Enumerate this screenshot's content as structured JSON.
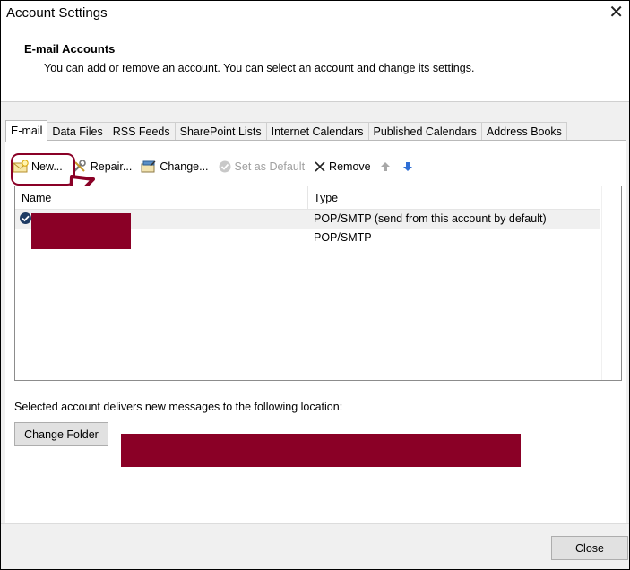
{
  "window": {
    "title": "Account Settings"
  },
  "header": {
    "title": "E-mail Accounts",
    "subtitle": "You can add or remove an account. You can select an account and change its settings."
  },
  "tabs": [
    {
      "label": "E-mail",
      "active": true
    },
    {
      "label": "Data Files"
    },
    {
      "label": "RSS Feeds"
    },
    {
      "label": "SharePoint Lists"
    },
    {
      "label": "Internet Calendars"
    },
    {
      "label": "Published Calendars"
    },
    {
      "label": "Address Books"
    }
  ],
  "toolbar": {
    "new_label": "New...",
    "repair_label": "Repair...",
    "change_label": "Change...",
    "set_default_label": "Set as Default",
    "remove_label": "Remove"
  },
  "accounts_table": {
    "columns": [
      "Name",
      "Type"
    ],
    "rows": [
      {
        "type": "POP/SMTP (send from this account by default)",
        "default": true
      },
      {
        "type": "POP/SMTP",
        "default": false
      }
    ]
  },
  "delivery": {
    "text": "Selected account delivers new messages to the following location:",
    "change_folder_label": "Change Folder"
  },
  "footer": {
    "close_label": "Close"
  },
  "colors": {
    "annotation": "#8a0026",
    "redaction": "#8a0026",
    "accent": "#0078d7"
  }
}
